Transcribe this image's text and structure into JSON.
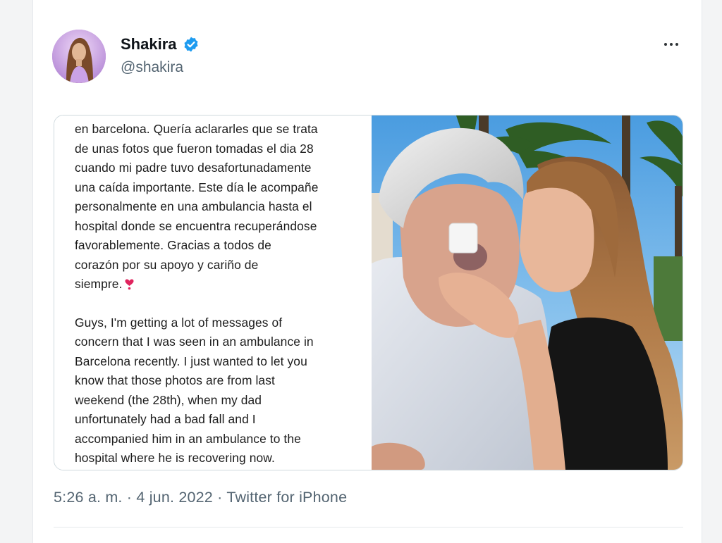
{
  "user": {
    "display_name": "Shakira",
    "handle": "@shakira",
    "verified": true,
    "avatar_icon": "profile-photo"
  },
  "tweet": {
    "caption_spanish": [
      "en barcelona. Quería aclararles que se trata",
      "de unas fotos que fueron tomadas el dia 28",
      "cuando mi padre tuvo desafortunadamente",
      "una caída importante. Este día le acompañe",
      "personalmente en una ambulancia hasta el",
      "hospital donde se encuentra recuperándose",
      "favorablemente. Gracias a todos de",
      "corazón por su apoyo y cariño de",
      "siempre."
    ],
    "caption_english": [
      "Guys, I'm getting a lot of messages of",
      "concern that I was seen in an ambulance in",
      "Barcelona recently. I just wanted to let you",
      "know that those photos are from last",
      "weekend (the 28th), when my dad",
      "unfortunately had a bad fall and I",
      "accompanied him in an ambulance to the",
      "hospital where he is recovering now."
    ],
    "heart_icon": "heart-exclamation-icon"
  },
  "meta": {
    "time": "5:26 a. m.",
    "separator": "·",
    "date": "4 jun. 2022",
    "source": "Twitter for iPhone"
  },
  "colors": {
    "verified_blue": "#1d9bf0",
    "secondary_text": "#536471",
    "heart_red": "#e0245e"
  }
}
